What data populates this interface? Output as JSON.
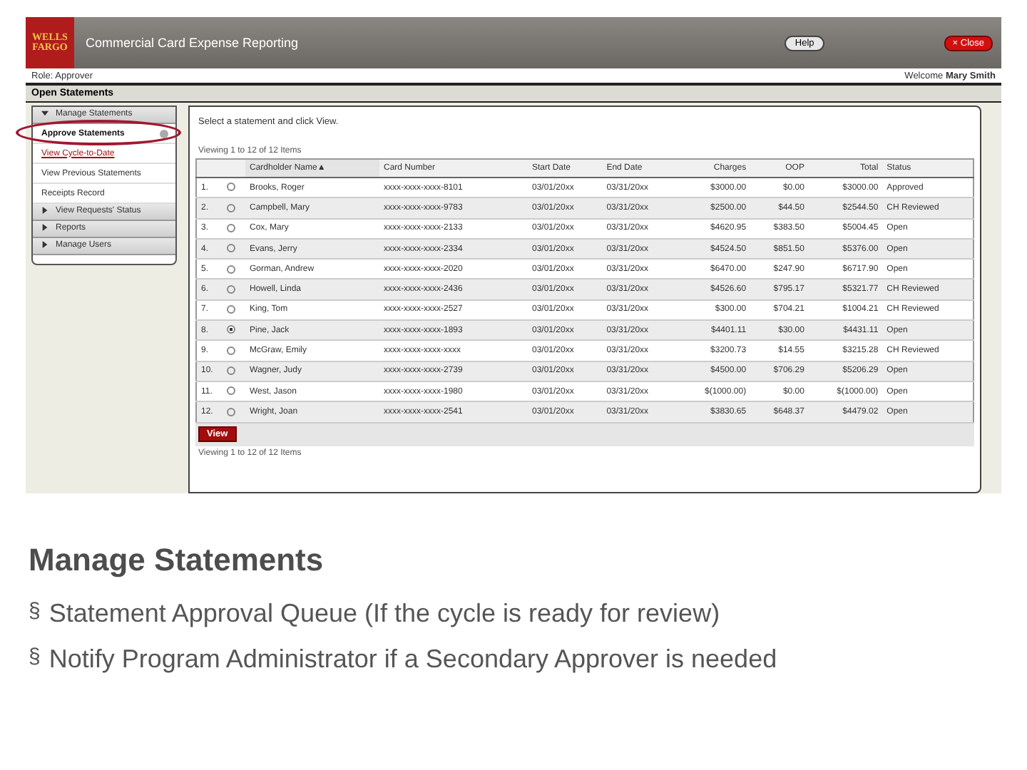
{
  "app": {
    "logo": [
      "WELLS",
      "FARGO"
    ],
    "title": "Commercial Card Expense Reporting",
    "help_button": "Help",
    "close_button": {
      "icon": "×",
      "label": "Close"
    }
  },
  "role_bar": {
    "label": "Role:",
    "role": "Approver",
    "welcome": "Welcome",
    "user": "Mary Smith"
  },
  "section_title": "Open Statements",
  "sidebar": [
    {
      "label": "Manage Statements",
      "expanded": true,
      "children": [
        {
          "label": "Approve Statements",
          "selected": true,
          "kind": "current"
        },
        {
          "label": "View Cycle-to-Date",
          "selected": false,
          "kind": "link"
        },
        {
          "label": "View Previous Statements",
          "selected": false,
          "kind": "plain"
        },
        {
          "label": "Receipts Record",
          "selected": false,
          "kind": "plain"
        }
      ]
    },
    {
      "label": "View Requests' Status",
      "expanded": false
    },
    {
      "label": "Reports",
      "expanded": false
    },
    {
      "label": "Manage Users",
      "expanded": false
    }
  ],
  "instruction": "Select a statement and click View.",
  "viewing_top": "Viewing 1 to 12 of 12 Items",
  "table": {
    "columns": [
      {
        "sorted": false
      },
      {
        "sorted": false
      },
      {
        "label": "Cardholder Name",
        "sorted": true
      },
      {
        "label": "Card Number",
        "sorted": false
      },
      {
        "label": "Start Date",
        "sorted": false
      },
      {
        "label": "End Date",
        "sorted": false
      },
      {
        "label": "Charges",
        "sorted": false
      },
      {
        "label": "OOP",
        "sorted": false
      },
      {
        "label": "Total",
        "sorted": false
      },
      {
        "label": "Status",
        "sorted": false
      }
    ],
    "sort_mark": "▲",
    "rows": [
      {
        "num": "1.",
        "selected": false,
        "name": "Brooks, Roger",
        "card": "xxxx-xxxx-xxxx-8101",
        "start": "03/01/20xx",
        "end": "03/31/20xx",
        "charges": "$3000.00",
        "oop": "$0.00",
        "total": "$3000.00",
        "status": "Approved"
      },
      {
        "num": "2.",
        "selected": false,
        "name": "Campbell, Mary",
        "card": "xxxx-xxxx-xxxx-9783",
        "start": "03/01/20xx",
        "end": "03/31/20xx",
        "charges": "$2500.00",
        "oop": "$44.50",
        "total": "$2544.50",
        "status": "CH Reviewed"
      },
      {
        "num": "3.",
        "selected": false,
        "name": "Cox, Mary",
        "card": "xxxx-xxxx-xxxx-2133",
        "start": "03/01/20xx",
        "end": "03/31/20xx",
        "charges": "$4620.95",
        "oop": "$383.50",
        "total": "$5004.45",
        "status": "Open"
      },
      {
        "num": "4.",
        "selected": false,
        "name": "Evans, Jerry",
        "card": "xxxx-xxxx-xxxx-2334",
        "start": "03/01/20xx",
        "end": "03/31/20xx",
        "charges": "$4524.50",
        "oop": "$851.50",
        "total": "$5376.00",
        "status": "Open"
      },
      {
        "num": "5.",
        "selected": false,
        "name": "Gorman, Andrew",
        "card": "xxxx-xxxx-xxxx-2020",
        "start": "03/01/20xx",
        "end": "03/31/20xx",
        "charges": "$6470.00",
        "oop": "$247.90",
        "total": "$6717.90",
        "status": "Open"
      },
      {
        "num": "6.",
        "selected": false,
        "name": "Howell, Linda",
        "card": "xxxx-xxxx-xxxx-2436",
        "start": "03/01/20xx",
        "end": "03/31/20xx",
        "charges": "$4526.60",
        "oop": "$795.17",
        "total": "$5321.77",
        "status": "CH Reviewed"
      },
      {
        "num": "7.",
        "selected": false,
        "name": "King, Tom",
        "card": "xxxx-xxxx-xxxx-2527",
        "start": "03/01/20xx",
        "end": "03/31/20xx",
        "charges": "$300.00",
        "oop": "$704.21",
        "total": "$1004.21",
        "status": "CH Reviewed"
      },
      {
        "num": "8.",
        "selected": true,
        "name": "Pine, Jack",
        "card": "xxxx-xxxx-xxxx-1893",
        "start": "03/01/20xx",
        "end": "03/31/20xx",
        "charges": "$4401.11",
        "oop": "$30.00",
        "total": "$4431.11",
        "status": "Open"
      },
      {
        "num": "9.",
        "selected": false,
        "name": "McGraw, Emily",
        "card": "xxxx-xxxx-xxxx-xxxx",
        "start": "03/01/20xx",
        "end": "03/31/20xx",
        "charges": "$3200.73",
        "oop": "$14.55",
        "total": "$3215.28",
        "status": "CH Reviewed"
      },
      {
        "num": "10.",
        "selected": false,
        "name": "Wagner, Judy",
        "card": "xxxx-xxxx-xxxx-2739",
        "start": "03/01/20xx",
        "end": "03/31/20xx",
        "charges": "$4500.00",
        "oop": "$706.29",
        "total": "$5206.29",
        "status": "Open"
      },
      {
        "num": "11.",
        "selected": false,
        "name": "West, Jason",
        "card": "xxxx-xxxx-xxxx-1980",
        "start": "03/01/20xx",
        "end": "03/31/20xx",
        "charges": "$(1000.00)",
        "oop": "$0.00",
        "total": "$(1000.00)",
        "status": "Open"
      },
      {
        "num": "12.",
        "selected": false,
        "name": "Wright, Joan",
        "card": "xxxx-xxxx-xxxx-2541",
        "start": "03/01/20xx",
        "end": "03/31/20xx",
        "charges": "$3830.65",
        "oop": "$648.37",
        "total": "$4479.02",
        "status": "Open"
      }
    ]
  },
  "view_button": "View",
  "viewing_bottom": "Viewing 1 to 12 of 12 Items",
  "slide": {
    "heading": "Manage Statements",
    "bullets": [
      {
        "mark": "§",
        "text": "Statement Approval Queue (If the cycle is ready for review)"
      },
      {
        "mark": "§",
        "text": "Notify Program Administrator if a Secondary Approver is needed"
      }
    ]
  }
}
